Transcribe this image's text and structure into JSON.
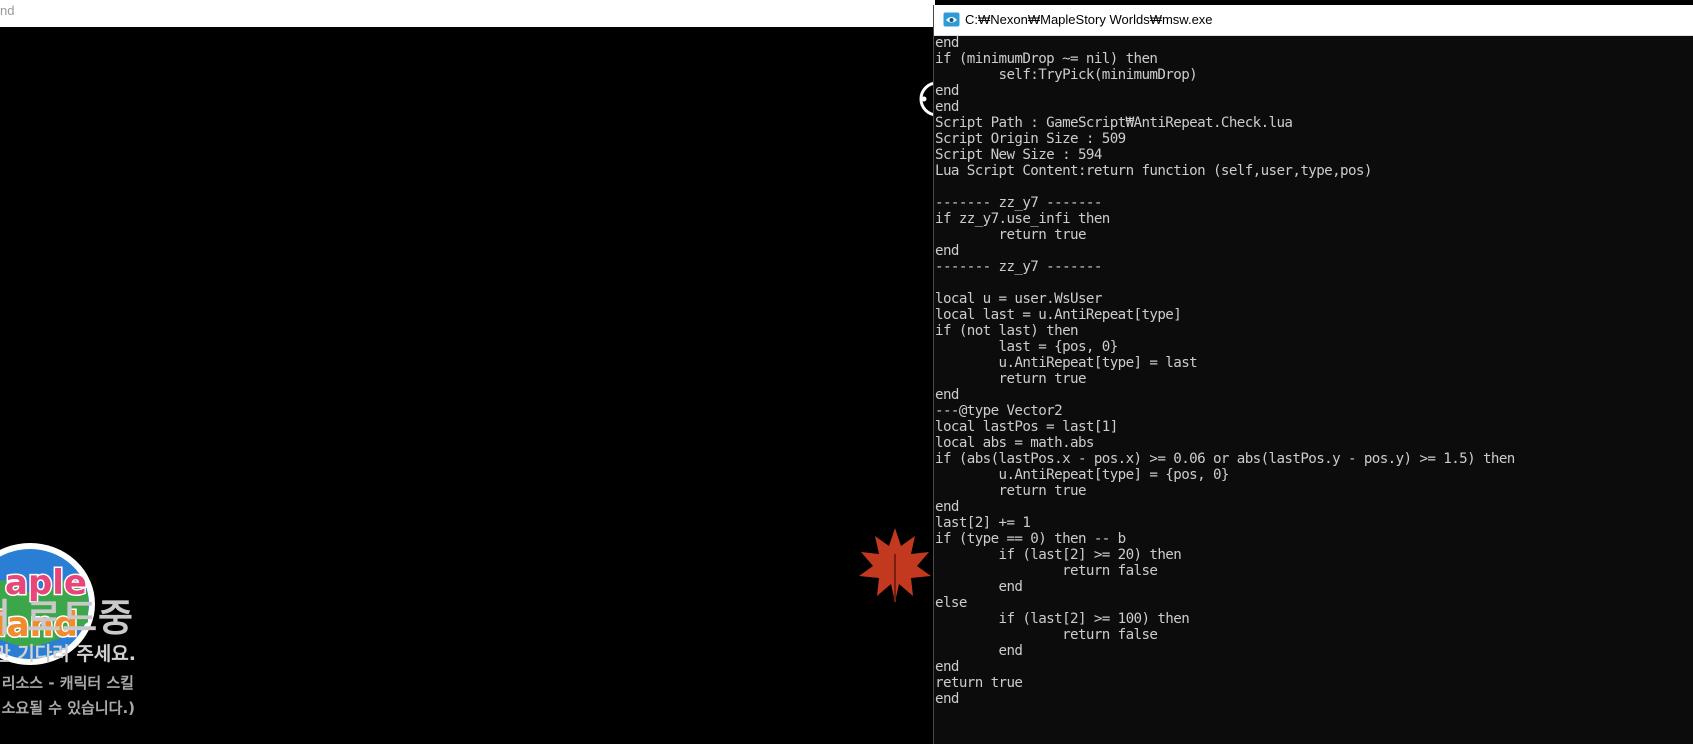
{
  "background_window": {
    "title_fragment": "nd"
  },
  "loading": {
    "title": "데이터 로드중",
    "subtitle": "잠시만 기다려 주세요.",
    "resource_status": "불러오는 중: 리소스 - 캐릭터 스킬",
    "note": "(리소스 다운로드에 다소 시간이 소요될 수 있습니다.)",
    "logo_text_line1": "aple",
    "logo_text_line2": "land"
  },
  "colors": {
    "console_bg": "#0c0c0c",
    "console_text": "#cccccc",
    "leaf": "#c2391f",
    "loading_text": "#c9c9c9"
  },
  "console": {
    "title": "C:₩Nexon₩MapleStory Worlds₩msw.exe",
    "icon": "console-app-icon",
    "lines": [
      "end",
      "if (minimumDrop ~= nil) then",
      "        self:TryPick(minimumDrop)",
      "end",
      "end",
      "Script Path : GameScript₩AntiRepeat.Check.lua",
      "Script Origin Size : 509",
      "Script New Size : 594",
      "Lua Script Content:return function (self,user,type,pos)",
      "",
      "------- zz_y7 -------",
      "if zz_y7.use_infi then",
      "        return true",
      "end",
      "------- zz_y7 -------",
      "",
      "local u = user.WsUser",
      "local last = u.AntiRepeat[type]",
      "if (not last) then",
      "        last = {pos, 0}",
      "        u.AntiRepeat[type] = last",
      "        return true",
      "end",
      "---@type Vector2",
      "local lastPos = last[1]",
      "local abs = math.abs",
      "if (abs(lastPos.x - pos.x) >= 0.06 or abs(lastPos.y - pos.y) >= 1.5) then",
      "        u.AntiRepeat[type] = {pos, 0}",
      "        return true",
      "end",
      "last[2] += 1",
      "if (type == 0) then -- b",
      "        if (last[2] >= 20) then",
      "                return false",
      "        end",
      "else",
      "        if (last[2] >= 100) then",
      "                return false",
      "        end",
      "end",
      "return true",
      "end"
    ]
  }
}
